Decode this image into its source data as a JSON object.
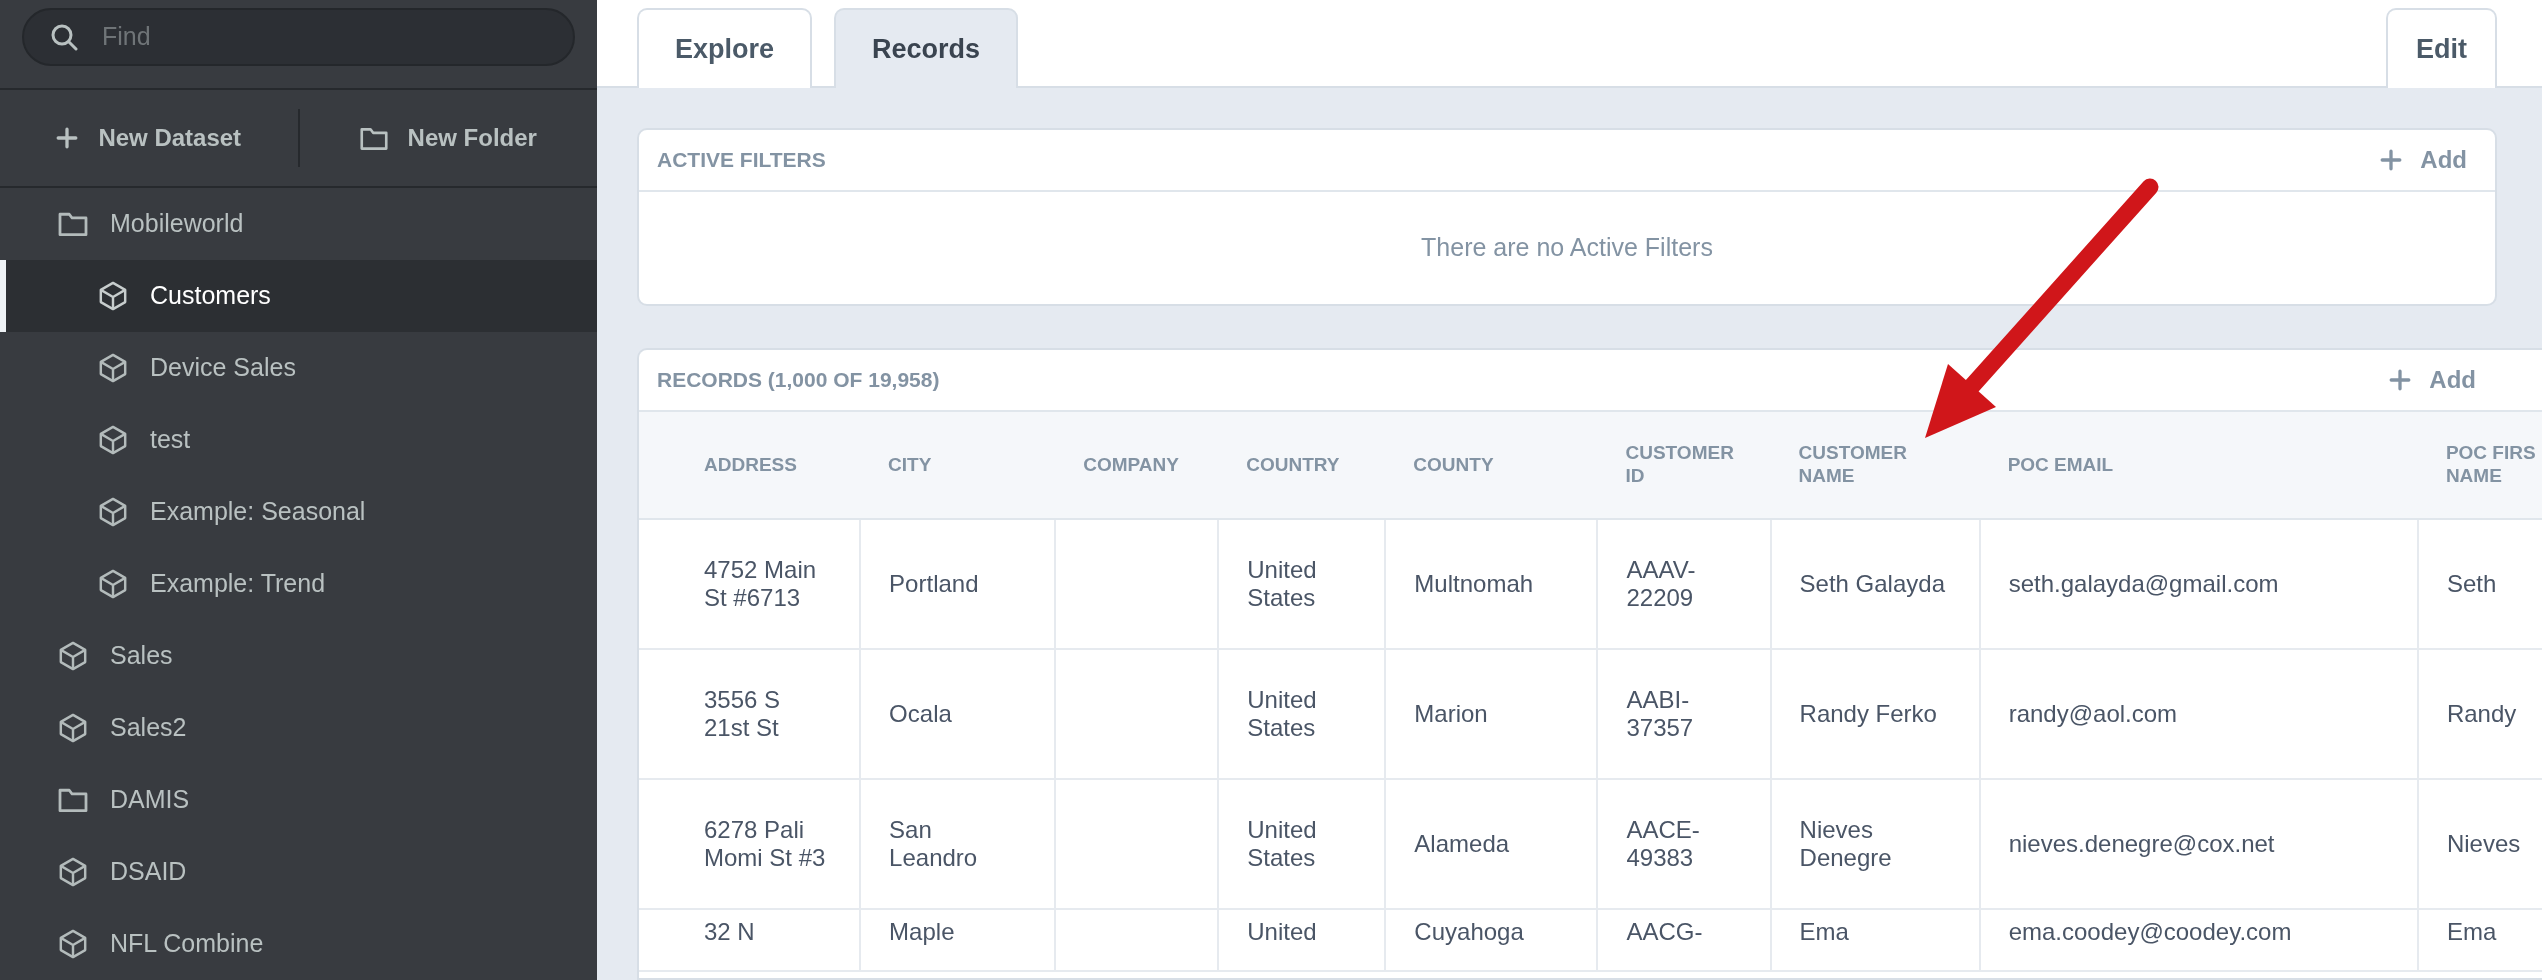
{
  "sidebar": {
    "search": {
      "placeholder": "Find"
    },
    "actions": [
      {
        "label": "New Dataset",
        "kind": "plus"
      },
      {
        "label": "New Folder",
        "kind": "folder"
      }
    ],
    "items": [
      {
        "label": "Mobileworld",
        "kind": "folder",
        "selected": false,
        "children": [
          {
            "label": "Customers",
            "kind": "dataset",
            "selected": true
          },
          {
            "label": "Device Sales",
            "kind": "dataset",
            "selected": false
          },
          {
            "label": "test",
            "kind": "dataset",
            "selected": false
          },
          {
            "label": "Example: Seasonal",
            "kind": "dataset",
            "selected": false
          },
          {
            "label": "Example: Trend",
            "kind": "dataset",
            "selected": false
          }
        ]
      },
      {
        "label": "Sales",
        "kind": "dataset",
        "selected": false
      },
      {
        "label": "Sales2",
        "kind": "dataset",
        "selected": false
      },
      {
        "label": "DAMIS",
        "kind": "folder",
        "selected": false
      },
      {
        "label": "DSAID",
        "kind": "dataset",
        "selected": false
      },
      {
        "label": "NFL Combine",
        "kind": "dataset",
        "selected": false
      }
    ]
  },
  "tabs": [
    {
      "label": "Explore",
      "selected": false
    },
    {
      "label": "Records",
      "selected": true
    }
  ],
  "edit_button": "Edit",
  "filters": {
    "title": "ACTIVE FILTERS",
    "add": "Add",
    "empty": "There are no Active Filters"
  },
  "records": {
    "title": "RECORDS (1,000 OF 19,958)",
    "add": "Add",
    "columns": [
      "ADDRESS",
      "CITY",
      "COMPANY",
      "COUNTRY",
      "COUNTY",
      "CUSTOMER ID",
      "CUSTOMER NAME",
      "POC EMAIL",
      "POC FIRS NAME"
    ],
    "rows": [
      [
        "4752 Main St #6713",
        "Portland",
        "",
        "United States",
        "Multnomah",
        "AAAV-22209",
        "Seth Galayda",
        "seth.galayda@gmail.com",
        "Seth"
      ],
      [
        "3556 S 21st St",
        "Ocala",
        "",
        "United States",
        "Marion",
        "AABI-37357",
        "Randy Ferko",
        "randy@aol.com",
        "Randy"
      ],
      [
        "6278 Pali Momi St #3",
        "San Leandro",
        "",
        "United States",
        "Alameda",
        "AACE-49383",
        "Nieves Denegre",
        "nieves.denegre@cox.net",
        "Nieves"
      ],
      [
        "32 N",
        "Maple",
        "",
        "United",
        "Cuyahoga",
        "AACG-",
        "Ema",
        "ema.coodey@coodey.com",
        "Ema"
      ]
    ]
  },
  "annotation": {
    "kind": "arrow"
  }
}
